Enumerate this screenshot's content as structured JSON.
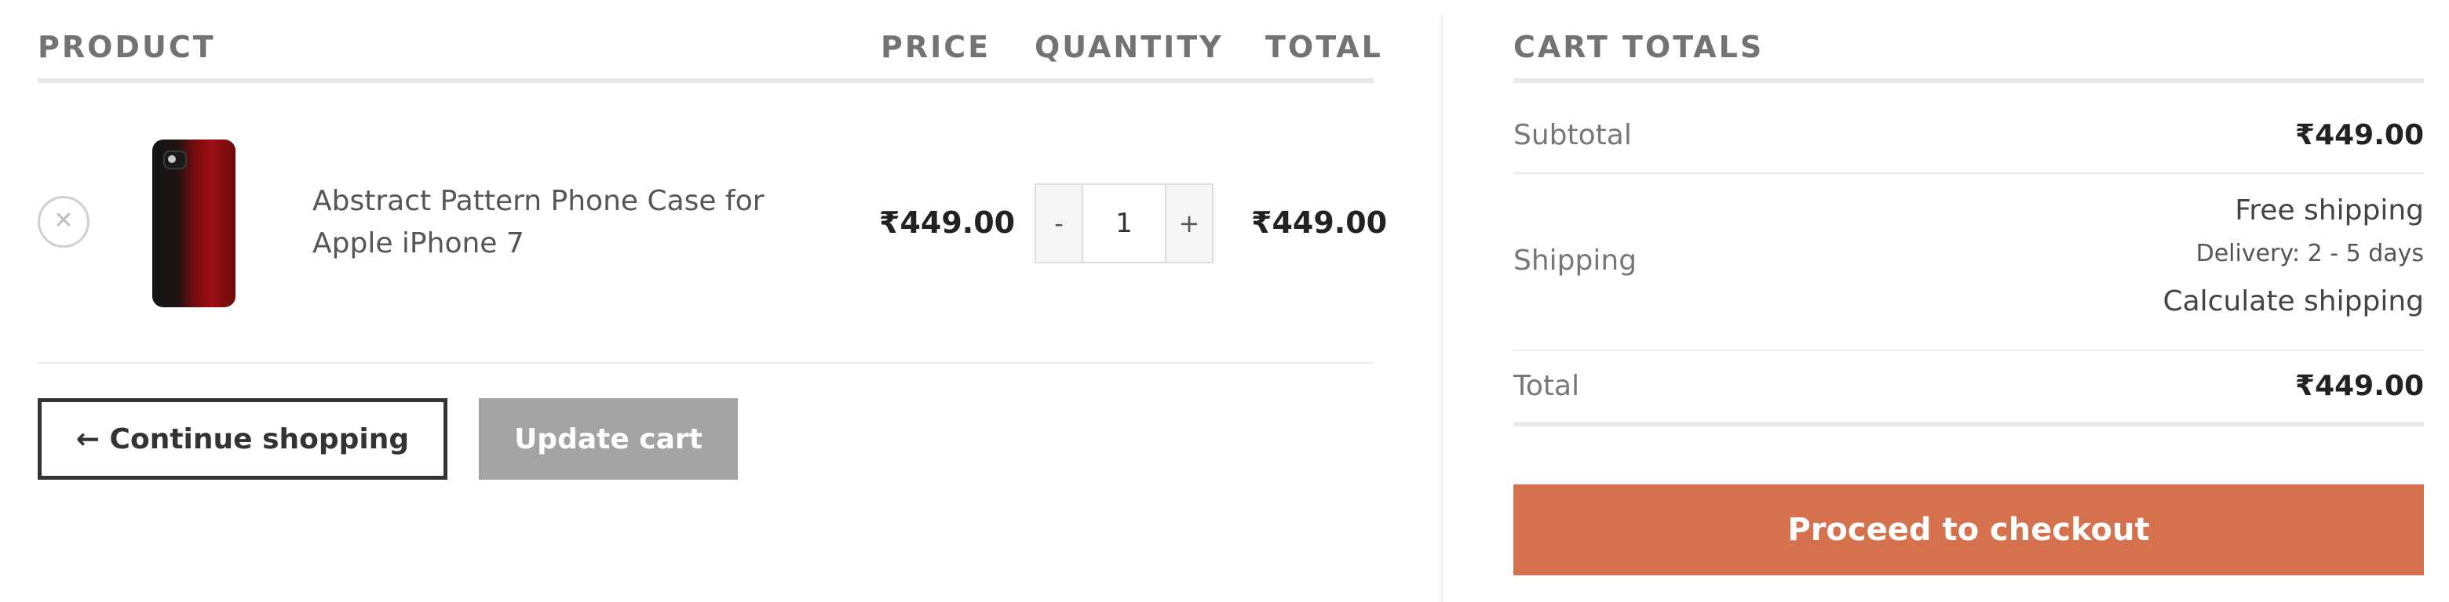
{
  "cart_table": {
    "headers": {
      "product": "PRODUCT",
      "price": "PRICE",
      "quantity": "QUANTITY",
      "total": "TOTAL"
    },
    "items": [
      {
        "remove_icon": "close-icon",
        "name": "Abstract Pattern Phone Case for Apple iPhone 7",
        "price": "₹449.00",
        "quantity": "1",
        "decrement_label": "-",
        "increment_label": "+",
        "subtotal": "₹449.00"
      }
    ]
  },
  "actions": {
    "continue_shopping": "← Continue shopping",
    "update_cart": "Update cart"
  },
  "cart_totals": {
    "title": "CART TOTALS",
    "subtotal_label": "Subtotal",
    "subtotal_value": "₹449.00",
    "shipping_label": "Shipping",
    "shipping_method": "Free shipping",
    "delivery_note": "Delivery: 2 - 5 days",
    "calculate_shipping": "Calculate shipping",
    "total_label": "Total",
    "total_value": "₹449.00",
    "checkout_button": "Proceed to checkout"
  },
  "colors": {
    "accent": "#d5714d",
    "update_button": "#a3a3a3",
    "header_text": "#737373"
  }
}
